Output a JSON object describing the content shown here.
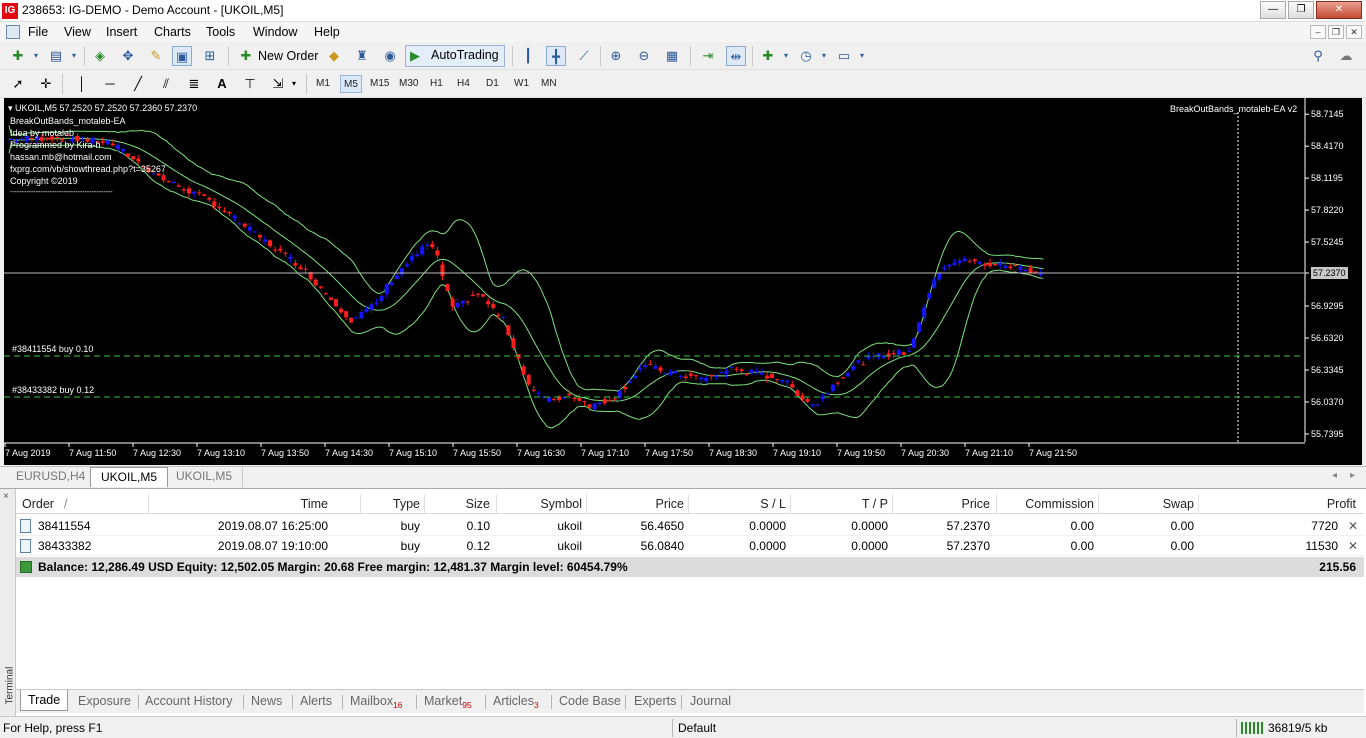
{
  "window": {
    "logo": "IG",
    "title": "238653: IG-DEMO - Demo Account - [UKOIL,M5]",
    "controls": [
      "—",
      "❐",
      "✕"
    ]
  },
  "menu": {
    "items": [
      "File",
      "View",
      "Insert",
      "Charts",
      "Tools",
      "Window",
      "Help"
    ],
    "mdi_controls": [
      "–",
      "❐",
      "✕"
    ]
  },
  "toolbar": {
    "new_order": "New Order",
    "autotrading": "AutoTrading"
  },
  "timeframes": [
    "M1",
    "M5",
    "M15",
    "M30",
    "H1",
    "H4",
    "D1",
    "W1",
    "MN"
  ],
  "active_timeframe": "M5",
  "chart": {
    "header": "UKOIL,M5  57.2520 57.2520 57.2360 57.2370",
    "ea_name": "BreakOutBands_motaleb-EA",
    "ea_corner": "BreakOutBands_motaleb-EA v2",
    "info_lines": [
      "Idea by motaleb",
      "Programmed by Kira-h",
      "hassan.mb@hotmail.com",
      "fxprg.com/vb/showthread.php?t=35267",
      "Copyright ©2019",
      "--------------------------------------------"
    ],
    "order_lines": [
      {
        "label": "#38411554 buy 0.10",
        "price": 56.465
      },
      {
        "label": "#38433382 buy 0.12",
        "price": 56.084
      }
    ],
    "current_price": 57.237,
    "price_labels": [
      "58.7145",
      "58.4170",
      "58.1195",
      "57.8220",
      "57.5245",
      "57.2370",
      "56.9295",
      "56.6320",
      "56.3345",
      "56.0370",
      "55.7395"
    ],
    "time_labels": [
      "7 Aug 2019",
      "7 Aug 11:50",
      "7 Aug 12:30",
      "7 Aug 13:10",
      "7 Aug 13:50",
      "7 Aug 14:30",
      "7 Aug 15:10",
      "7 Aug 15:50",
      "7 Aug 16:30",
      "7 Aug 17:10",
      "7 Aug 17:50",
      "7 Aug 18:30",
      "7 Aug 19:10",
      "7 Aug 19:50",
      "7 Aug 20:30",
      "7 Aug 21:10",
      "7 Aug 21:50"
    ],
    "colors": {
      "up": "#1414ff",
      "down": "#ff1e1e",
      "bands": "#7ee07e",
      "order_line": "#3cc03c",
      "grid": "#ffffff"
    }
  },
  "chart_tabs": [
    "EURUSD,H4",
    "UKOIL,M5",
    "UKOIL,M5"
  ],
  "active_chart_tab": 1,
  "terminal": {
    "side_label": "Terminal",
    "close": "×",
    "columns": [
      "Order",
      "Time",
      "Type",
      "Size",
      "Symbol",
      "Price",
      "S / L",
      "T / P",
      "Price",
      "Commission",
      "Swap",
      "Profit"
    ],
    "sort_indicator": "/",
    "rows": [
      {
        "order": "38411554",
        "time": "2019.08.07 16:25:00",
        "type": "buy",
        "size": "0.10",
        "symbol": "ukoil",
        "price": "56.4650",
        "sl": "0.0000",
        "tp": "0.0000",
        "cur": "57.2370",
        "commission": "0.00",
        "swap": "0.00",
        "profit": "7720"
      },
      {
        "order": "38433382",
        "time": "2019.08.07 19:10:00",
        "type": "buy",
        "size": "0.12",
        "symbol": "ukoil",
        "price": "56.0840",
        "sl": "0.0000",
        "tp": "0.0000",
        "cur": "57.2370",
        "commission": "0.00",
        "swap": "0.00",
        "profit": "11530"
      }
    ],
    "balance_line": "Balance: 12,286.49 USD  Equity: 12,502.05  Margin: 20.68  Free margin: 12,481.37  Margin level: 60454.79%",
    "balance_total": "215.56",
    "tabs": [
      {
        "label": "Trade",
        "badge": ""
      },
      {
        "label": "Exposure",
        "badge": ""
      },
      {
        "label": "Account History",
        "badge": ""
      },
      {
        "label": "News",
        "badge": ""
      },
      {
        "label": "Alerts",
        "badge": ""
      },
      {
        "label": "Mailbox",
        "badge": "16"
      },
      {
        "label": "Market",
        "badge": "95"
      },
      {
        "label": "Articles",
        "badge": "3"
      },
      {
        "label": "Code Base",
        "badge": ""
      },
      {
        "label": "Experts",
        "badge": ""
      },
      {
        "label": "Journal",
        "badge": ""
      }
    ]
  },
  "status": {
    "help": "For Help, press F1",
    "profile": "Default",
    "traffic": "36819/5 kb"
  }
}
